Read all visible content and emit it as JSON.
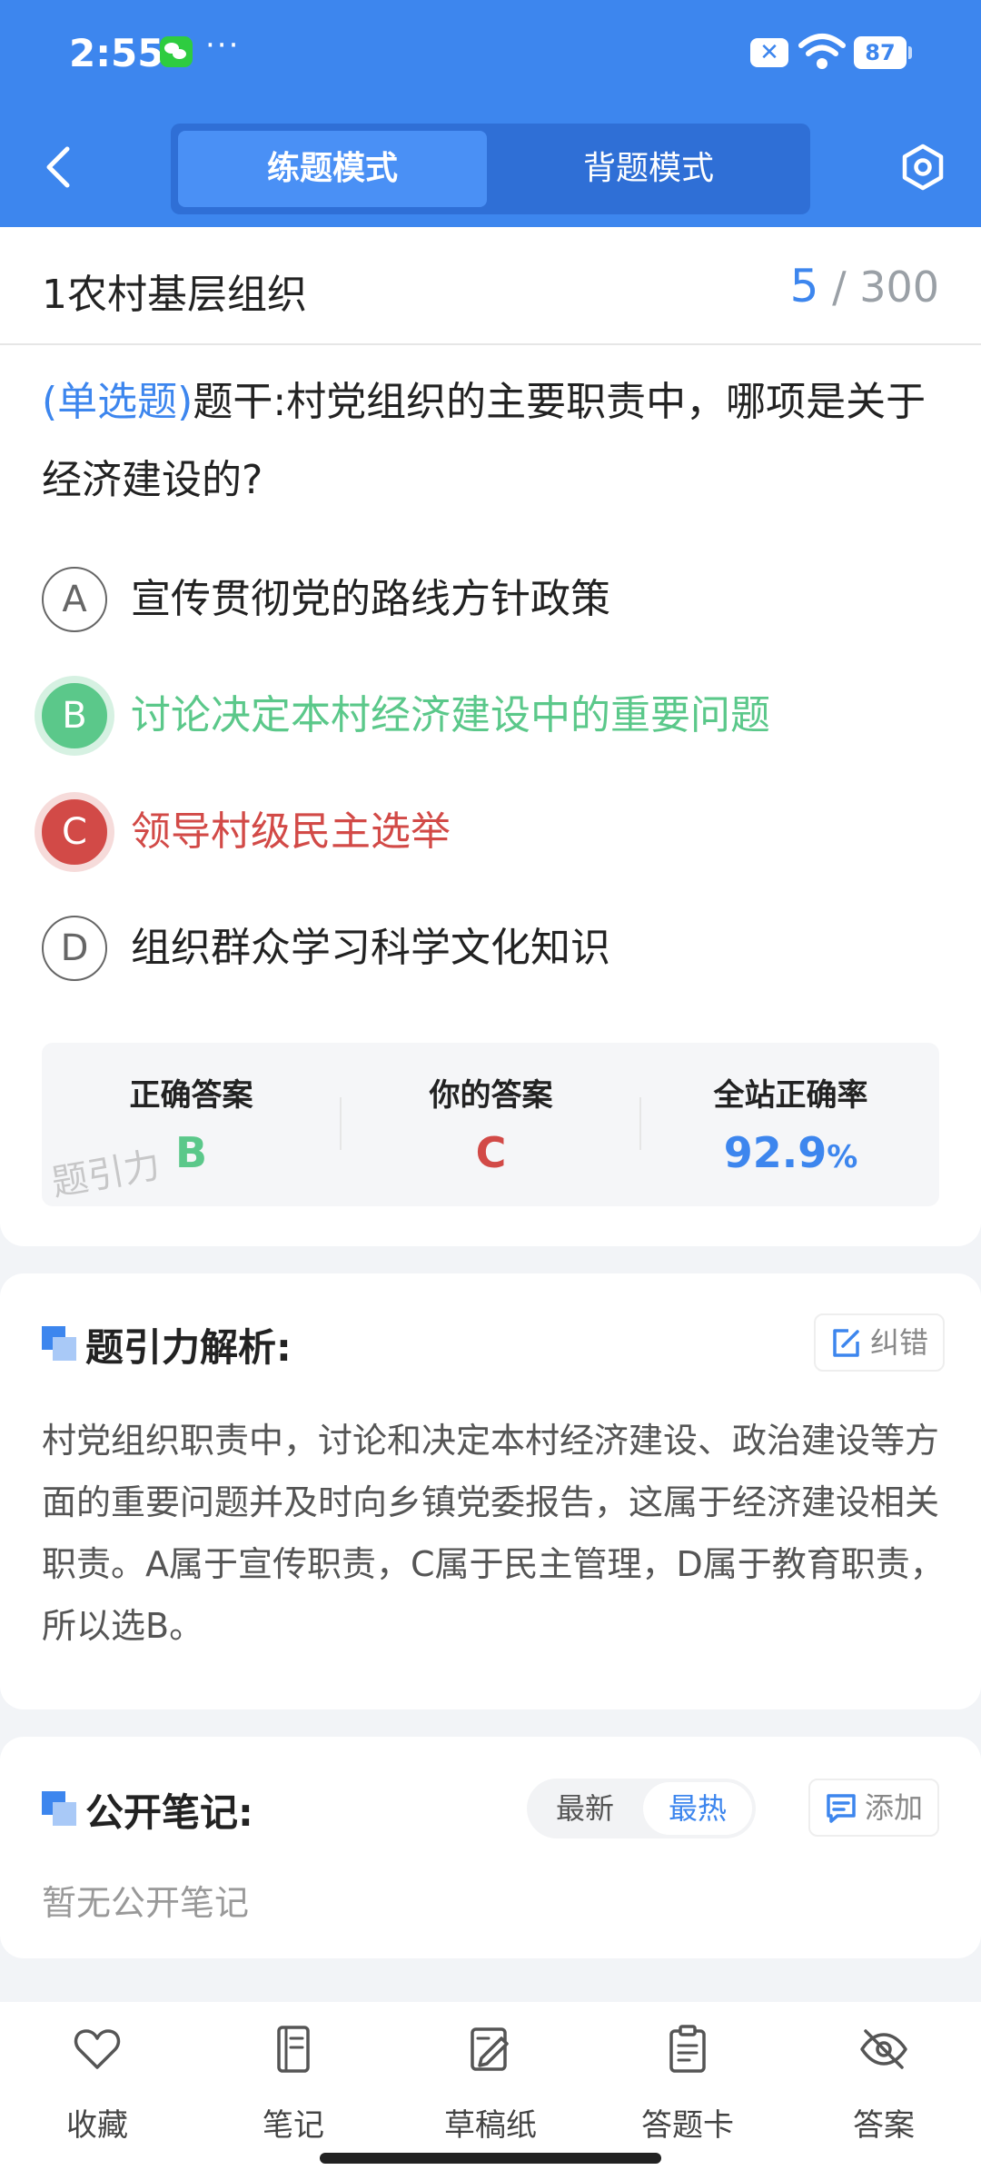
{
  "status_bar": {
    "time": "2:55",
    "dots": "···",
    "battery": "87"
  },
  "header": {
    "modes": [
      {
        "label": "练题模式",
        "active": true
      },
      {
        "label": "背题模式",
        "active": false
      }
    ]
  },
  "chapter": {
    "title": "1农村基层组织",
    "current": "5",
    "total": "/ 300"
  },
  "question": {
    "type": "(单选题)",
    "text": "题干:村党组织的主要职责中，哪项是关于经济建设的?"
  },
  "options": [
    {
      "letter": "A",
      "text": "宣传贯彻党的路线方针政策",
      "state": "normal"
    },
    {
      "letter": "B",
      "text": "讨论决定本村经济建设中的重要问题",
      "state": "correct"
    },
    {
      "letter": "C",
      "text": "领导村级民主选举",
      "state": "wrong"
    },
    {
      "letter": "D",
      "text": "组织群众学习科学文化知识",
      "state": "normal"
    }
  ],
  "answers": {
    "correct_label": "正确答案",
    "correct_value": "B",
    "yours_label": "你的答案",
    "yours_value": "C",
    "rate_label": "全站正确率",
    "rate_value": "92.9",
    "rate_unit": "%",
    "watermark": "题引力"
  },
  "analysis": {
    "title": "题引力解析:",
    "report_label": "纠错",
    "text": "村党组织职责中，讨论和决定本村经济建设、政治建设等方面的重要问题并及时向乡镇党委报告，这属于经济建设相关职责。A属于宣传职责，C属于民主管理，D属于教育职责，所以选B。"
  },
  "notes": {
    "title": "公开笔记:",
    "sort_latest": "最新",
    "sort_hot": "最热",
    "add_label": "添加",
    "empty": "暂无公开笔记"
  },
  "bottom_nav": [
    {
      "label": "收藏",
      "icon": "heart-icon"
    },
    {
      "label": "笔记",
      "icon": "notebook-icon"
    },
    {
      "label": "草稿纸",
      "icon": "draft-paper-icon"
    },
    {
      "label": "答题卡",
      "icon": "answer-sheet-icon"
    },
    {
      "label": "答案",
      "icon": "eye-hidden-icon"
    }
  ],
  "colors": {
    "brand_blue": "#3d86ee",
    "correct_green": "#5bc88a",
    "wrong_red": "#d24a47"
  }
}
